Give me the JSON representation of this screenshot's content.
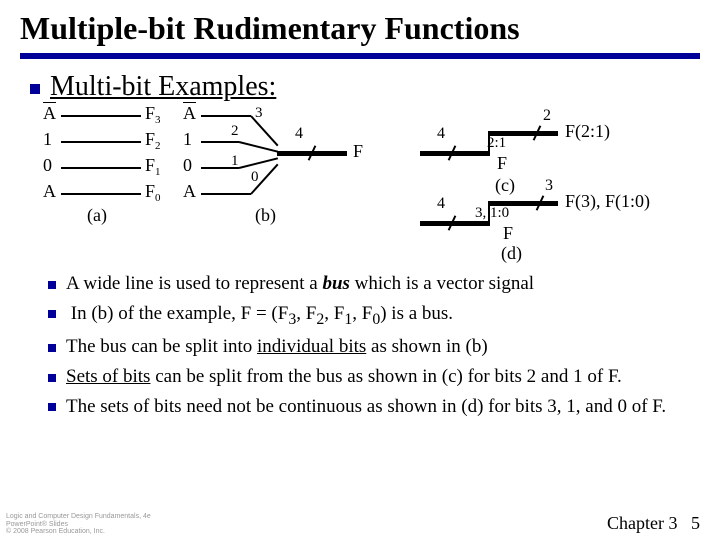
{
  "title": "Multiple-bit Rudimentary Functions",
  "heading": "Multi-bit Examples:",
  "diagram": {
    "colA": {
      "in": [
        "A",
        "1",
        "0",
        "A"
      ],
      "out": [
        "F",
        "F",
        "F",
        "F"
      ],
      "sub": [
        "3",
        "2",
        "1",
        "0"
      ],
      "cap": "(a)"
    },
    "colB": {
      "in": [
        "A",
        "1",
        "0",
        "A"
      ],
      "n": [
        "3",
        "2",
        "1",
        "0"
      ],
      "bus4": "4",
      "Flabel": "F",
      "cap": "(b)"
    },
    "colC": {
      "bus4": "4",
      "sel": "2:1",
      "out2": "2",
      "Flabel": "F",
      "Fout": "F(2:1)",
      "cap": "(c)"
    },
    "colD": {
      "bus4": "4",
      "sel": "3, 1:0",
      "out3": "3",
      "Flabel": "F",
      "Fout": "F(3), F(1:0)",
      "cap": "(d)"
    }
  },
  "bullets": [
    {
      "pre": "A wide line is used to represent a ",
      "em": "bus",
      "post": " which is a vector signal"
    },
    {
      "text_html": " In (b) of the example, F = (F<sub>3</sub>, F<sub>2</sub>, F<sub>1</sub>, F<sub>0</sub>) is a bus."
    },
    {
      "pre": "The bus can be split into ",
      "u": "individual bits",
      "post": " as shown in (b)"
    },
    {
      "pre": "",
      "u": "Sets of bits",
      "post": " can be split from the bus as shown in (c) for bits 2 and 1 of F."
    },
    {
      "text": "The sets of bits need not be continuous as shown in (d) for bits 3, 1, and 0 of F."
    }
  ],
  "footer": {
    "left": "Logic and Computer Design Fundamentals, 4e\nPowerPoint® Slides\n© 2008 Pearson Education, Inc.",
    "chapter": "Chapter 3",
    "page": "5"
  }
}
